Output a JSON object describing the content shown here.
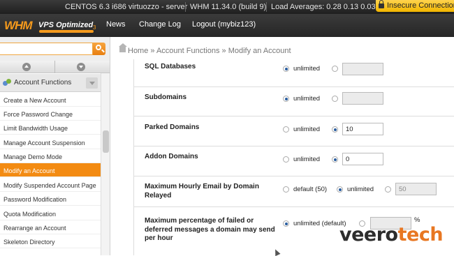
{
  "topbar": {
    "os": "CENTOS 6.3 i686 virtuozzo - server",
    "whm": "WHM 11.34.0 (build 9)",
    "load": "Load Averages: 0.28 0.13 0.03",
    "insecure": "Insecure Connection"
  },
  "brand": {
    "whm": "WHM",
    "vps": "VPS Optimized",
    "sub": "3"
  },
  "nav": {
    "news": "News",
    "changelog": "Change Log",
    "logout": "Logout (mybiz123)"
  },
  "search": {
    "placeholder": ""
  },
  "breadcrumb": "Home » Account Functions » Modify an Account",
  "sidebar": {
    "category": "Account Functions",
    "items": [
      {
        "label": "Create a New Account"
      },
      {
        "label": "Force Password Change"
      },
      {
        "label": "Limit Bandwidth Usage"
      },
      {
        "label": "Manage Account Suspension"
      },
      {
        "label": "Manage Demo Mode"
      },
      {
        "label": "Modify an Account"
      },
      {
        "label": "Modify Suspended Account Page"
      },
      {
        "label": "Password Modification"
      },
      {
        "label": "Quota Modification"
      },
      {
        "label": "Rearrange an Account"
      },
      {
        "label": "Skeleton Directory"
      }
    ]
  },
  "form": {
    "sql": {
      "label": "SQL Databases",
      "opt": "unlimited",
      "value": ""
    },
    "sub": {
      "label": "Subdomains",
      "opt": "unlimited",
      "value": ""
    },
    "parked": {
      "label": "Parked Domains",
      "opt": "unlimited",
      "value": "10"
    },
    "addon": {
      "label": "Addon Domains",
      "opt": "unlimited",
      "value": "0"
    },
    "email": {
      "label": "Maximum Hourly Email by Domain Relayed",
      "default": "default (50)",
      "unl": "unlimited",
      "value": "50"
    },
    "failed": {
      "label": "Maximum percentage of failed or deferred messages a domain may send per hour",
      "default": "unlimited (default)",
      "pct": "%"
    }
  },
  "watermark": {
    "a": "veero",
    "b": "tech"
  }
}
